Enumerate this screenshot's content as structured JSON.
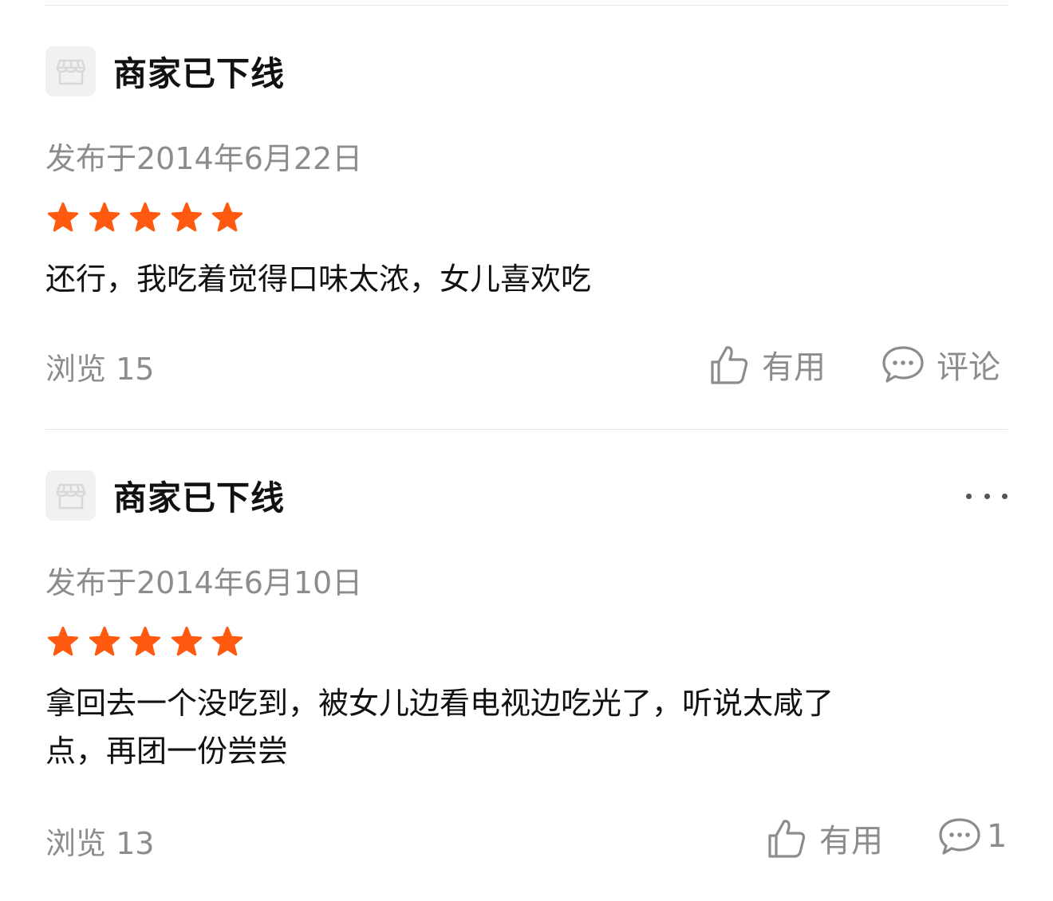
{
  "reviews": [
    {
      "merchant": "商家已下线",
      "date": "发布于2014年6月22日",
      "rating": 5,
      "content": "还行，我吃着觉得口味太浓，女儿喜欢吃",
      "views_label": "浏览",
      "views": "15",
      "helpful_label": "有用",
      "comment_label": "评论"
    },
    {
      "merchant": "商家已下线",
      "date": "发布于2014年6月10日",
      "rating": 5,
      "content": "拿回去一个没吃到，被女儿边看电视边吃光了，听说太咸了\n点，再团一份尝尝",
      "views_label": "浏览",
      "views": "13",
      "helpful_label": "有用",
      "comment_count": "1"
    }
  ],
  "colors": {
    "star": "#ff5a0f",
    "muted_text": "#8c8c8c",
    "divider": "#e6e6e6"
  },
  "icons": [
    "store-icon",
    "star-icon",
    "thumbs-up-icon",
    "comment-icon",
    "more-icon"
  ]
}
